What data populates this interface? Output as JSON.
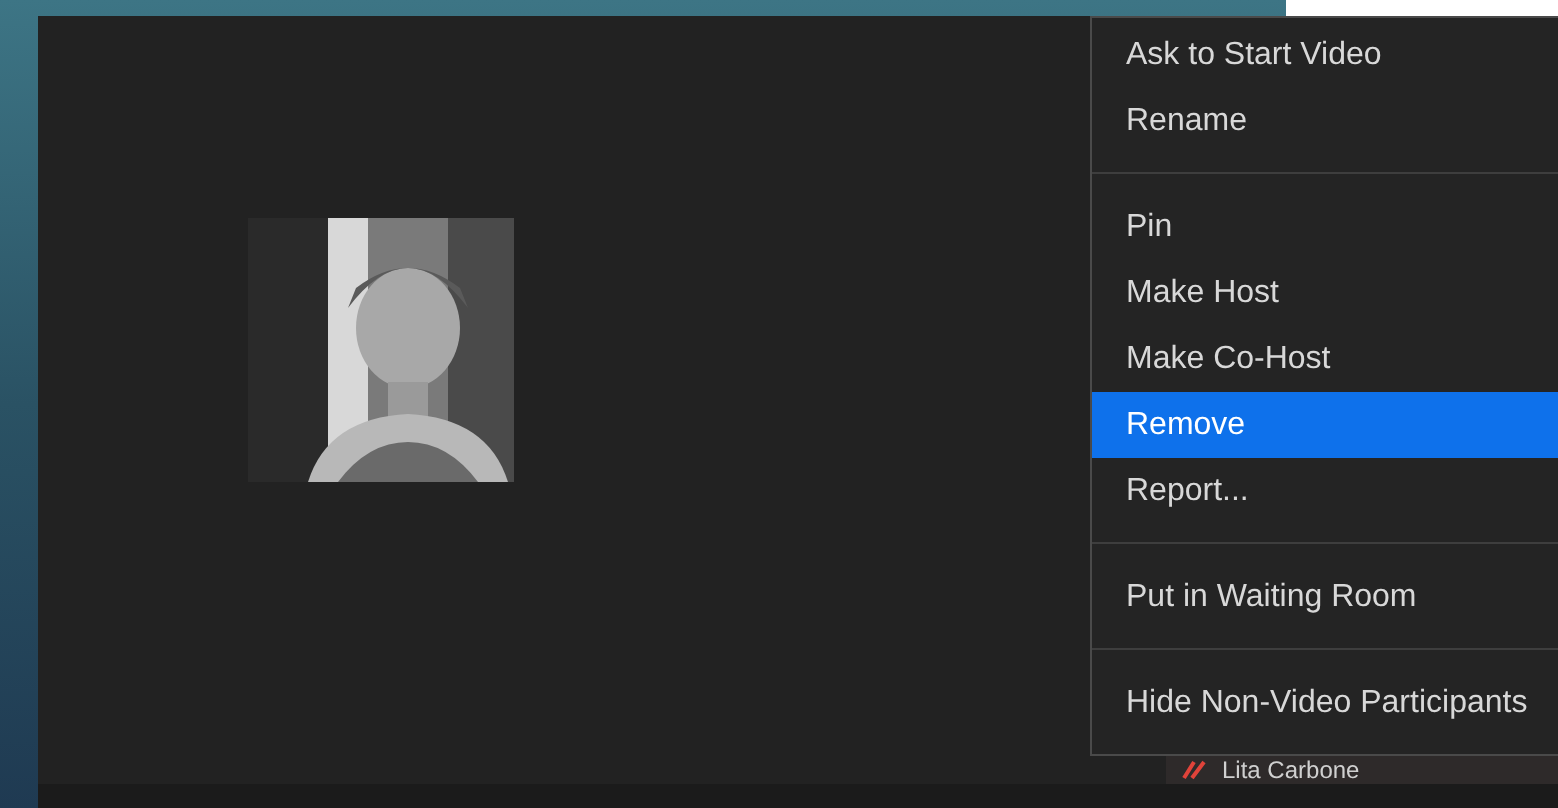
{
  "menu": {
    "groups": [
      [
        {
          "label": "Ask to Start Video",
          "selected": false
        },
        {
          "label": "Rename",
          "selected": false
        }
      ],
      [
        {
          "label": "Pin",
          "selected": false
        },
        {
          "label": "Make Host",
          "selected": false
        },
        {
          "label": "Make Co-Host",
          "selected": false
        },
        {
          "label": "Remove",
          "selected": true
        },
        {
          "label": "Report...",
          "selected": false
        }
      ],
      [
        {
          "label": "Put in Waiting Room",
          "selected": false
        }
      ],
      [
        {
          "label": "Hide Non-Video Participants",
          "selected": false
        }
      ]
    ]
  },
  "participant_strip": {
    "name": "Lita Carbone"
  }
}
